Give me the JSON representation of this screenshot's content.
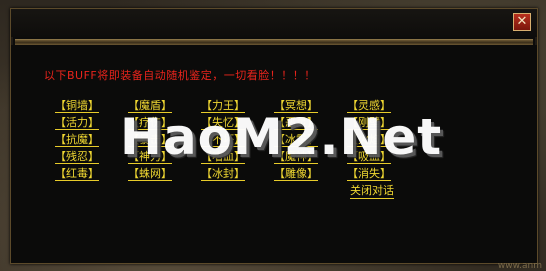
{
  "dialog": {
    "close_glyph": "✕",
    "notice": "以下BUFF将即装备自动随机鉴定，一切看脸！！！！",
    "close_dialog_label": "关闭对话"
  },
  "buffs": [
    [
      "【铜墙】",
      "【魔盾】",
      "【力王】",
      "【冥想】",
      "【灵感】"
    ],
    [
      "【活力】",
      "【疗伤】",
      "【失忆】",
      "【恶灵】",
      "【刚壁】"
    ],
    [
      "【抗魔】",
      "【暴击】",
      "【不坏】",
      "【冰霜】",
      "【火焰】"
    ],
    [
      "【残忍】",
      "【神力】",
      "【嗜血】",
      "【魔神】",
      "【吸血】"
    ],
    [
      "【红毒】",
      "【蛛网】",
      "【冰封】",
      "【雕像】",
      "【消失】"
    ]
  ],
  "watermark": "HaoM2.Net",
  "footer": "www.anm"
}
